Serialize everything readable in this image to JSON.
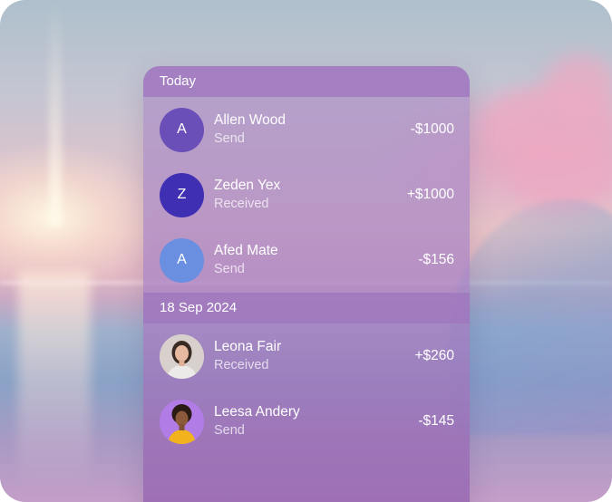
{
  "colors": {
    "avatar_allen": "#6b4fb8",
    "avatar_zeden": "#3f2fb3",
    "avatar_afed": "#6b8fe0",
    "avatar_leesa_bg": "#b27ce6"
  },
  "groups": [
    {
      "header": "Today",
      "transactions": [
        {
          "initial": "A",
          "name": "Allen Wood",
          "status": "Send",
          "amount": "-$1000"
        },
        {
          "initial": "Z",
          "name": "Zeden Yex",
          "status": "Received",
          "amount": "+$1000"
        },
        {
          "initial": "A",
          "name": "Afed Mate",
          "status": "Send",
          "amount": "-$156"
        }
      ]
    },
    {
      "header": "18 Sep 2024",
      "transactions": [
        {
          "avatar_icon": "person-photo-icon",
          "name": "Leona Fair",
          "status": "Received",
          "amount": "+$260"
        },
        {
          "avatar_icon": "person-photo-icon",
          "name": "Leesa Andery",
          "status": "Send",
          "amount": "-$145"
        }
      ]
    }
  ]
}
